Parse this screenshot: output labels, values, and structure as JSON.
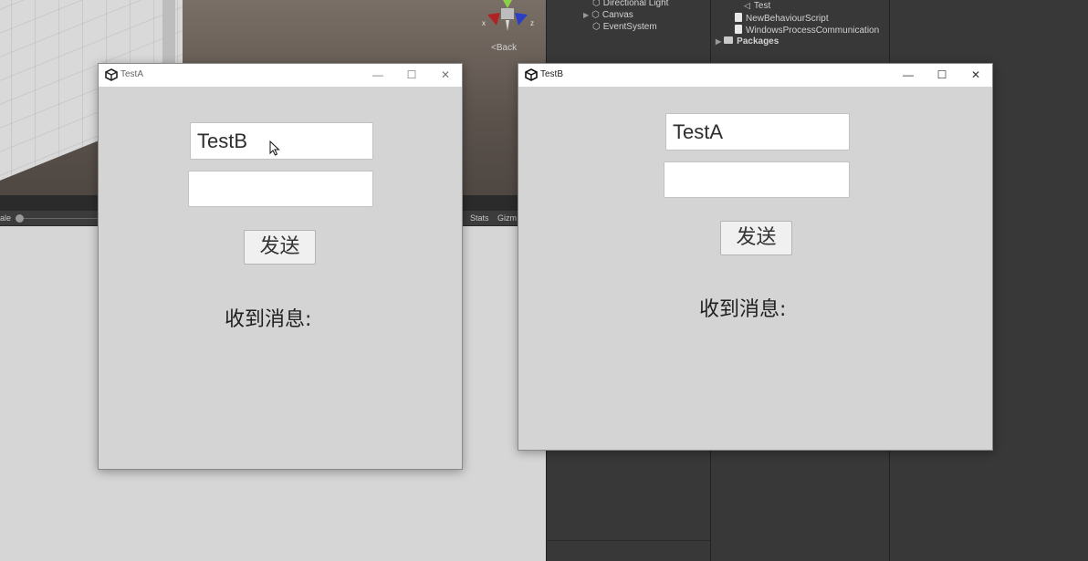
{
  "scene": {
    "back_label": "<Back",
    "toolbar": {
      "scale_label": "ale",
      "stats_label": "Stats",
      "gizmos_label": "Gizm"
    },
    "gizmo_axes": {
      "x_label": "x",
      "z_label": "z"
    }
  },
  "hierarchy": {
    "items": [
      {
        "label": "Directional Light",
        "expandable": false
      },
      {
        "label": "Canvas",
        "expandable": true
      },
      {
        "label": "EventSystem",
        "expandable": false
      }
    ]
  },
  "project": {
    "items": [
      {
        "label": "Test",
        "icon": "unity-scene-icon"
      },
      {
        "label": "NewBehaviourScript",
        "icon": "script-icon"
      },
      {
        "label": "WindowsProcessCommunication",
        "icon": "script-icon"
      },
      {
        "label": "Packages",
        "icon": "folder-icon"
      }
    ]
  },
  "windows": [
    {
      "title": "TestA",
      "name_value": "TestB",
      "message_value": "",
      "send_label": "发送",
      "received_label": "收到消息:"
    },
    {
      "title": "TestB",
      "name_value": "TestA",
      "message_value": "",
      "send_label": "发送",
      "received_label": "收到消息:"
    }
  ],
  "window_controls": {
    "minimize": "—",
    "maximize": "☐",
    "close": "✕"
  },
  "colors": {
    "gizmo_x": "#b02323",
    "gizmo_z": "#2b3fc4",
    "gizmo_y": "#8ad14a",
    "editor_bg": "#383838"
  }
}
